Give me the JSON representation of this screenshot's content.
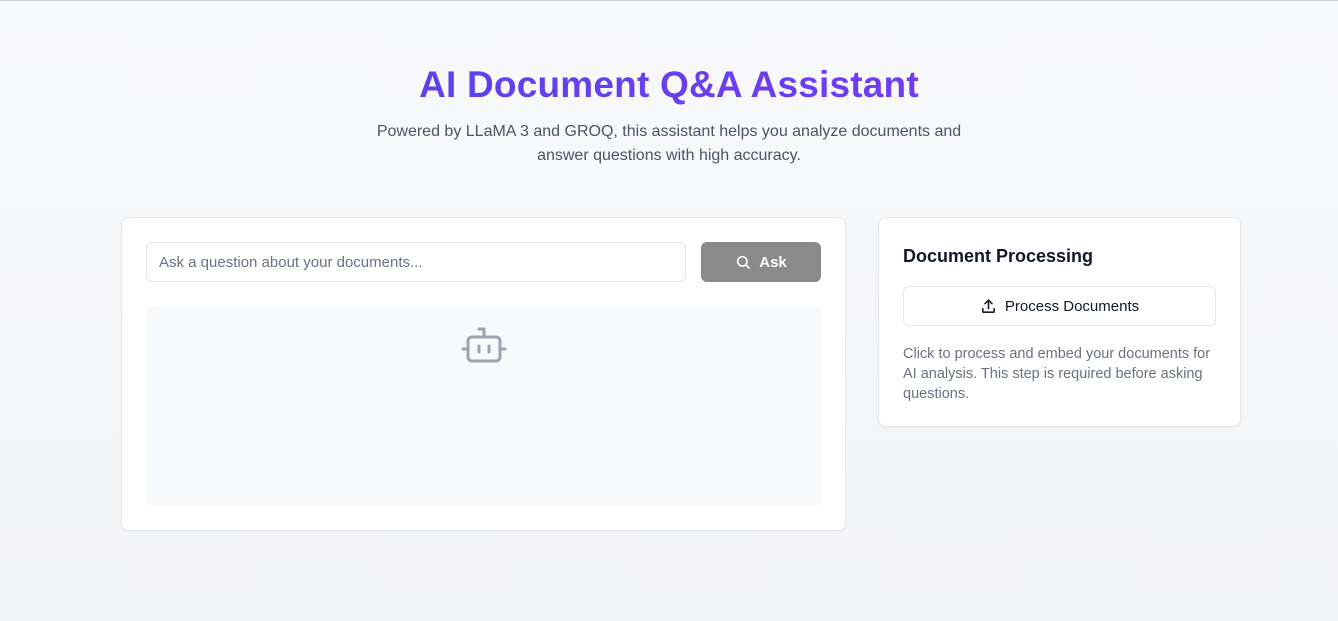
{
  "header": {
    "title": "AI Document Q&A Assistant",
    "subtitle": "Powered by LLaMA 3 and GROQ, this assistant helps you analyze documents and answer questions with high accuracy."
  },
  "qa": {
    "search_placeholder": "Ask a question about your documents...",
    "search_value": "",
    "ask_label": "Ask",
    "ask_icon": "search-icon",
    "answer_icon": "bot-icon"
  },
  "processing": {
    "title": "Document Processing",
    "button_label": "Process Documents",
    "button_icon": "upload-icon",
    "description": "Click to process and embed your documents for AI analysis. This step is required before asking questions."
  },
  "colors": {
    "title_gradient_start": "#4f46e5",
    "title_gradient_end": "#7c3aed",
    "ask_button_bg": "#8a8a8a",
    "bot_icon": "#9ca3af"
  }
}
